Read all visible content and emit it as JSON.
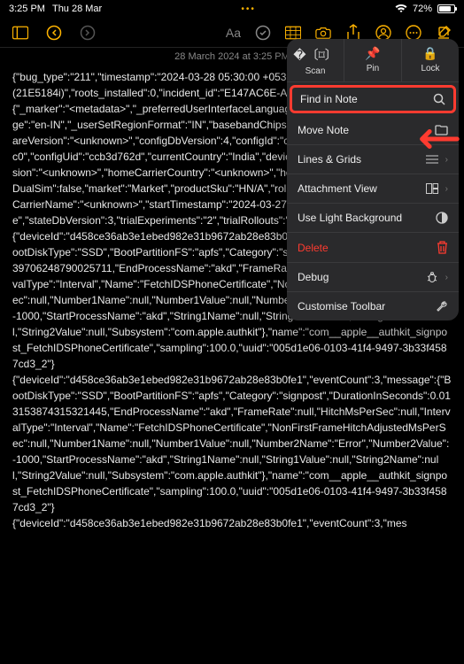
{
  "status": {
    "time": "3:25 PM",
    "date": "Thu 28 Mar",
    "battery": "72%"
  },
  "note": {
    "date": "28 March 2024 at 3:25 PM",
    "body": "{\"bug_type\":\"211\",\"timestamp\":\"2024-03-28 05:30:00 +0530\",\"os_version\":\"iPhone OS 17.4 (21E5184i)\",\"roots_installed\":0,\"incident_id\":\"E147AC6E-ABDD-5B99E3A1AA77\"}\n{\"_marker\":\"<metadata>\",\"_preferredUserInterfaceLanguage\":\"en-IN\",\"_userInterfaceLanguage\":\"en-IN\",\"_userSetRegionFormat\":\"IN\",\"basebandChipset\":\"<unknown>\",\"basebandFirmwareVersion\":\"<unknown>\",\"configDbVersion\":4,\"configId\":\"ccb3d7787-442d-9221-7e66ff169ac0\",\"configUid\":\"ccb3d762d\",\"currentCountry\":\"India\",\"deviceCapacity\":128,\"deviceBundleVersion\":\"<unknown>\",\"homeCarrierCountry\":\"<unknown>\",\"homeCarrierName\":\"<unknown>\",\"isDualSim\":false,\"market\":\"Market\",\"productSku\":\"HN/A\",\"rolloverReason\":\"scheduled\",\"servingCarrierName\":\"<unknown>\",\"startTimestamp\":\"2024-03-27T00:40:00Z\",\"stateDbType\":\"sqlite\",\"stateDbVersion\":3,\"trialExperiments\":\"2\",\"trialRollouts\":\"2\",\"version\":\"2.4\"}\n{\"deviceId\":\"d458ce36ab3e1ebed982e31b9672ab28e83b0fe1\",\"eventCount\":3,\"message\":{\"BootDiskType\":\"SSD\",\"BootPartitionFS\":\"apfs\",\"Category\":\"signpost\",\"DurationInSeconds\":0.0039706248790025711,\"EndProcessName\":\"akd\",\"FrameRate\":null,\"HitchMsPerSec\":null,\"IntervalType\":\"Interval\",\"Name\":\"FetchIDSPhoneCertificate\",\"NonFirstFrameHitchAdjustedMsPerSec\":null,\"Number1Name\":null,\"Number1Value\":null,\"Number2Name\":\"Error\",\"Number2Value\":-1000,\"StartProcessName\":\"akd\",\"String1Name\":null,\"String1Value\":null,\"String2Name\":null,\"String2Value\":null,\"Subsystem\":\"com.apple.authkit\"},\"name\":\"com__apple__authkit_signpost_FetchIDSPhoneCertificate\",\"sampling\":100.0,\"uuid\":\"005d1e06-0103-41f4-9497-3b33f4587cd3_2\"}\n{\"deviceId\":\"d458ce36ab3e1ebed982e31b9672ab28e83b0fe1\",\"eventCount\":3,\"message\":{\"BootDiskType\":\"SSD\",\"BootPartitionFS\":\"apfs\",\"Category\":\"signpost\",\"DurationInSeconds\":0.013153874315321445,\"EndProcessName\":\"akd\",\"FrameRate\":null,\"HitchMsPerSec\":null,\"IntervalType\":\"Interval\",\"Name\":\"FetchIDSPhoneCertificate\",\"NonFirstFrameHitchAdjustedMsPerSec\":null,\"Number1Name\":null,\"Number1Value\":null,\"Number2Name\":\"Error\",\"Number2Value\":-1000,\"StartProcessName\":\"akd\",\"String1Name\":null,\"String1Value\":null,\"String2Name\":null,\"String2Value\":null,\"Subsystem\":\"com.apple.authkit\"},\"name\":\"com__apple__authkit_signpost_FetchIDSPhoneCertificate\",\"sampling\":100.0,\"uuid\":\"005d1e06-0103-41f4-9497-3b33f4587cd3_2\"}\n{\"deviceId\":\"d458ce36ab3e1ebed982e31b9672ab28e83b0fe1\",\"eventCount\":3,\"mes"
  },
  "menu": {
    "scan": "Scan",
    "pin": "Pin",
    "lock": "Lock",
    "find": "Find in Note",
    "move": "Move Note",
    "lines": "Lines & Grids",
    "attachment": "Attachment View",
    "light": "Use Light Background",
    "delete": "Delete",
    "debug": "Debug",
    "customise": "Customise Toolbar"
  }
}
